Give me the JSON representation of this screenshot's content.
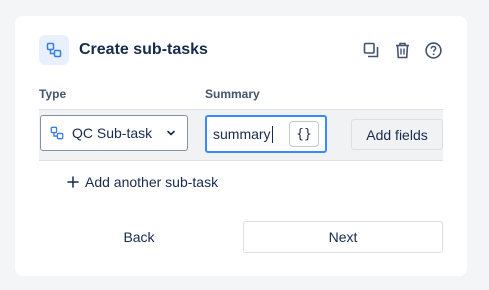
{
  "dialog": {
    "title": "Create sub-tasks",
    "header_icon": "subtask-icon",
    "actions": [
      {
        "name": "copy-icon"
      },
      {
        "name": "trash-icon"
      },
      {
        "name": "help-icon"
      }
    ]
  },
  "columns": {
    "type_label": "Type",
    "summary_label": "Summary"
  },
  "row": {
    "type_value": "QC Sub-task",
    "type_icon": "subtask-icon",
    "summary_value": "summary",
    "braces_label": "{}",
    "add_fields_label": "Add fields"
  },
  "add_another_label": "Add another sub-task",
  "footer": {
    "back_label": "Back",
    "next_label": "Next"
  },
  "colors": {
    "accent": "#388bff",
    "text": "#172b4d",
    "subtle_text": "#44546f",
    "icon_blue": "#357de8"
  }
}
